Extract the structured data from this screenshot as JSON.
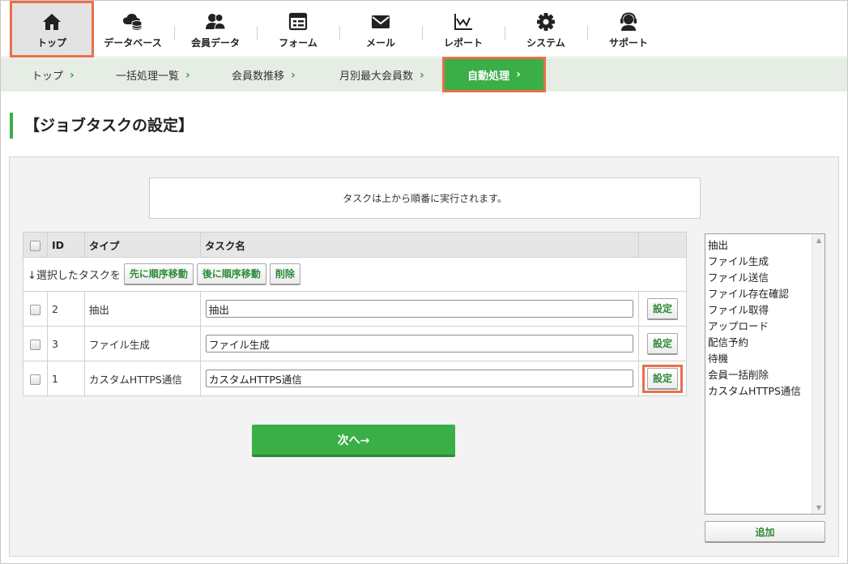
{
  "nav": {
    "items": [
      {
        "label": "トップ",
        "icon": "home-icon"
      },
      {
        "label": "データベース",
        "icon": "database-cloud-icon"
      },
      {
        "label": "会員データ",
        "icon": "members-icon"
      },
      {
        "label": "フォーム",
        "icon": "form-icon"
      },
      {
        "label": "メール",
        "icon": "mail-icon"
      },
      {
        "label": "レポート",
        "icon": "report-chart-icon"
      },
      {
        "label": "システム",
        "icon": "gear-icon"
      },
      {
        "label": "サポート",
        "icon": "support-headset-icon"
      }
    ],
    "active_index": 0
  },
  "breadcrumb": {
    "items": [
      "トップ",
      "一括処理一覧",
      "会員数推移",
      "月別最大会員数"
    ],
    "current": "自動処理"
  },
  "page": {
    "title": "【ジョブタスクの設定】",
    "notice": "タスクは上から順番に実行されます。"
  },
  "table": {
    "headers": {
      "id": "ID",
      "type": "タイプ",
      "name": "タスク名"
    },
    "action_lead": "↓選択したタスクを",
    "actions": {
      "move_up": "先に順序移動",
      "move_down": "後に順序移動",
      "delete": "削除"
    },
    "rows": [
      {
        "id": "2",
        "type": "抽出",
        "name": "抽出",
        "button": "設定"
      },
      {
        "id": "3",
        "type": "ファイル生成",
        "name": "ファイル生成",
        "button": "設定"
      },
      {
        "id": "1",
        "type": "カスタムHTTPS通信",
        "name": "カスタムHTTPS通信",
        "button": "設定"
      }
    ]
  },
  "next_button": "次へ→",
  "task_types": {
    "options": [
      "抽出",
      "ファイル生成",
      "ファイル送信",
      "ファイル存在確認",
      "ファイル取得",
      "アップロード",
      "配信予約",
      "待機",
      "会員一括削除",
      "カスタムHTTPS通信"
    ],
    "add_button": "追加"
  },
  "colors": {
    "accent_green": "#3aae47",
    "highlight_orange": "#e8704a",
    "breadcrumb_bg": "#e5ede5"
  }
}
